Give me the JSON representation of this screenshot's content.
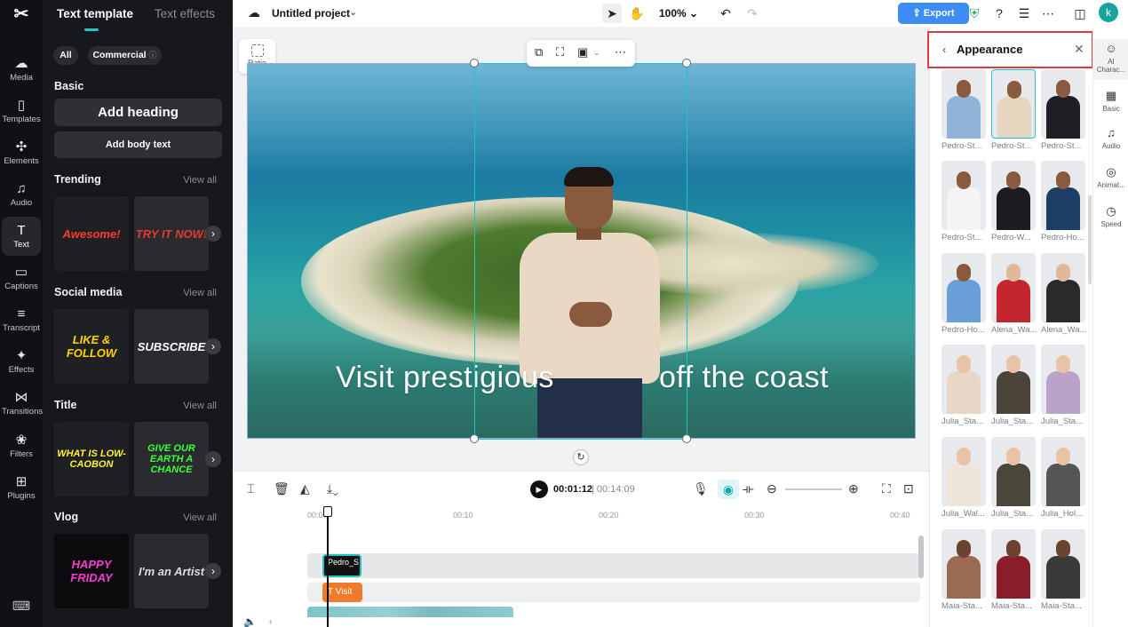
{
  "rail": {
    "logo": "✂",
    "items": [
      {
        "label": "Media",
        "icon": "☁"
      },
      {
        "label": "Templates",
        "icon": "▯"
      },
      {
        "label": "Elements",
        "icon": "✣"
      },
      {
        "label": "Audio",
        "icon": "♫"
      },
      {
        "label": "Text",
        "icon": "T"
      },
      {
        "label": "Captions",
        "icon": "▭"
      },
      {
        "label": "Transcript",
        "icon": "≡"
      },
      {
        "label": "Effects",
        "icon": "✦"
      },
      {
        "label": "Transitions",
        "icon": "⋈"
      },
      {
        "label": "Filters",
        "icon": "❀"
      },
      {
        "label": "Plugins",
        "icon": "⊞"
      }
    ],
    "keyboard_icon": "⌨"
  },
  "left_panel": {
    "tabs": [
      "Text template",
      "Text effects"
    ],
    "filters": {
      "all": "All",
      "commercial": "Commercial",
      "commercial_info": "ⓘ"
    },
    "basic": {
      "title": "Basic",
      "add_heading": "Add heading",
      "add_body": "Add body text"
    },
    "view_all": "View all",
    "sections": [
      {
        "title": "Trending",
        "thumbs": [
          {
            "text": "Awesome!",
            "color": "#ff3b30",
            "bg": "#1f2023"
          },
          {
            "text": "TRY IT NOW!",
            "color": "#e53935",
            "bg": "#2a2b2e"
          }
        ]
      },
      {
        "title": "Social media",
        "thumbs": [
          {
            "text": "LIKE & FOLLOW",
            "color": "#ffd400",
            "bg": "#1f2023"
          },
          {
            "text": "SUBSCRIBE",
            "color": "#ffffff",
            "bg": "#2a2b2e"
          }
        ]
      },
      {
        "title": "Title",
        "thumbs": [
          {
            "text": "WHAT IS LOW-CAOBON",
            "color": "#ffef3a",
            "bg": "#1f2023"
          },
          {
            "text": "GIVE OUR EARTH A CHANCE",
            "color": "#3bff3b",
            "bg": "#2a2b2e"
          }
        ]
      },
      {
        "title": "Vlog",
        "thumbs": [
          {
            "text": "HAPPY FRIDAY",
            "color": "#ff3bd5",
            "bg": "#0b0b0d"
          },
          {
            "text": "I'm an Artist",
            "color": "#dddddd",
            "bg": "#2a2b2e"
          }
        ]
      }
    ]
  },
  "topbar": {
    "project_name": "Untitled project",
    "zoom": "100%",
    "export": "Export",
    "avatar_letter": "k"
  },
  "canvas": {
    "ratio_label": "Ratio",
    "caption_left": "Visit prestigious",
    "caption_right": "off the coast"
  },
  "timeline": {
    "current_time": "00:01:12",
    "total_time": "| 00:14:09",
    "ruler": [
      "00:00",
      "00:10",
      "00:20",
      "00:30",
      "00:40"
    ],
    "avatar_clip": "Pedro_S",
    "text_clip": "Visit"
  },
  "appearance": {
    "title": "Appearance",
    "avatars": [
      {
        "name": "Pedro-St...",
        "skin": "#8a5a3e",
        "outfit": "#8fb4d8",
        "selected": false
      },
      {
        "name": "Pedro-St...",
        "skin": "#8a5a3e",
        "outfit": "#e7d5bf",
        "selected": true
      },
      {
        "name": "Pedro-St...",
        "skin": "#8a5a3e",
        "outfit": "#1d1f24",
        "selected": false
      },
      {
        "name": "Pedro-St...",
        "skin": "#8a5a3e",
        "outfit": "#f4f4f4",
        "selected": false
      },
      {
        "name": "Pedro-W...",
        "skin": "#8a5a3e",
        "outfit": "#1a1c22",
        "selected": false
      },
      {
        "name": "Pedro-Ho...",
        "skin": "#8a5a3e",
        "outfit": "#1b3d66",
        "selected": false
      },
      {
        "name": "Pedro-Ho...",
        "skin": "#8a5a3e",
        "outfit": "#6a9ed6",
        "selected": false
      },
      {
        "name": "Alena_Wa...",
        "skin": "#e2b89a",
        "outfit": "#c4262e",
        "selected": false
      },
      {
        "name": "Alena_Wa...",
        "skin": "#e2b89a",
        "outfit": "#2a2a2a",
        "selected": false
      },
      {
        "name": "Julia_Sta...",
        "skin": "#e9c3a6",
        "outfit": "#e8d6c6",
        "selected": false
      },
      {
        "name": "Julia_Sta...",
        "skin": "#e9c3a6",
        "outfit": "#4a4538",
        "selected": false
      },
      {
        "name": "Julia_Sta...",
        "skin": "#e9c3a6",
        "outfit": "#b9a3c9",
        "selected": false
      },
      {
        "name": "Julia_Wal...",
        "skin": "#e9c3a6",
        "outfit": "#efe5da",
        "selected": false
      },
      {
        "name": "Julia_Sta...",
        "skin": "#e9c3a6",
        "outfit": "#4b463a",
        "selected": false
      },
      {
        "name": "Julia_Hol...",
        "skin": "#e9c3a6",
        "outfit": "#555555",
        "selected": false
      },
      {
        "name": "Maia-Sta...",
        "skin": "#6b4330",
        "outfit": "#9a6a52",
        "selected": false
      },
      {
        "name": "Maia-Sta...",
        "skin": "#6b4330",
        "outfit": "#8a1e28",
        "selected": false
      },
      {
        "name": "Maia-Sta...",
        "skin": "#6b4330",
        "outfit": "#3a3a3a",
        "selected": false
      }
    ]
  },
  "right_rail": [
    {
      "label": "AI Charac...",
      "icon": "☺"
    },
    {
      "label": "Basic",
      "icon": "▦"
    },
    {
      "label": "Audio",
      "icon": "♫"
    },
    {
      "label": "Animat...",
      "icon": "◎"
    },
    {
      "label": "Speed",
      "icon": "◷"
    }
  ]
}
